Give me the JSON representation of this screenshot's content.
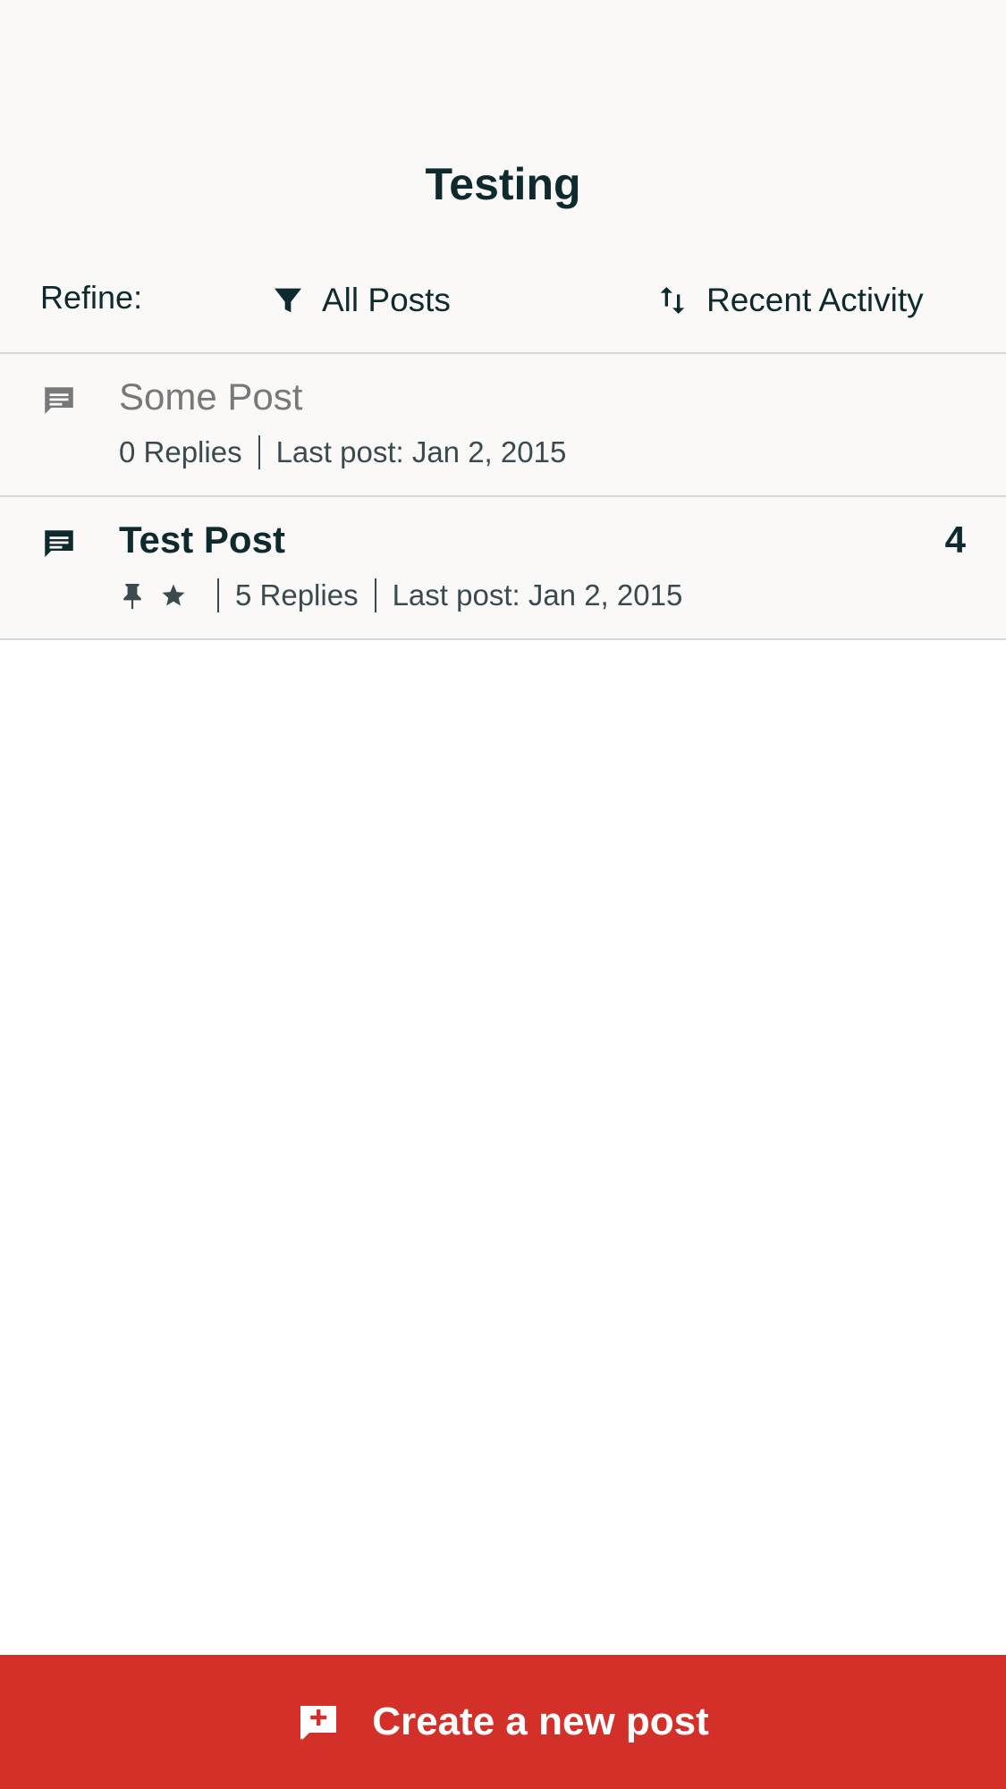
{
  "header": {
    "title": "Testing"
  },
  "refine": {
    "label": "Refine:",
    "filter": {
      "icon": "filter-icon",
      "label": "All Posts"
    },
    "sort": {
      "icon": "sort-icon",
      "label": "Recent Activity"
    }
  },
  "posts": [
    {
      "icon": "chat-bubble-icon",
      "title": "Some Post",
      "replies": "0 Replies",
      "last_post": "Last post: Jan 2, 2015"
    },
    {
      "icon": "chat-bubble-icon",
      "title": "Test Post",
      "pinned_icon": "pin-icon",
      "starred_icon": "star-icon",
      "replies": "5 Replies",
      "last_post": "Last post: Jan 2, 2015",
      "unread_count": "4"
    }
  ],
  "footer": {
    "icon": "add-comment-icon",
    "label": "Create a new post"
  },
  "colors": {
    "accent": "#d3302a",
    "text_dark": "#0f2a2e",
    "text_muted": "#787878",
    "surface": "#faf9f7"
  }
}
